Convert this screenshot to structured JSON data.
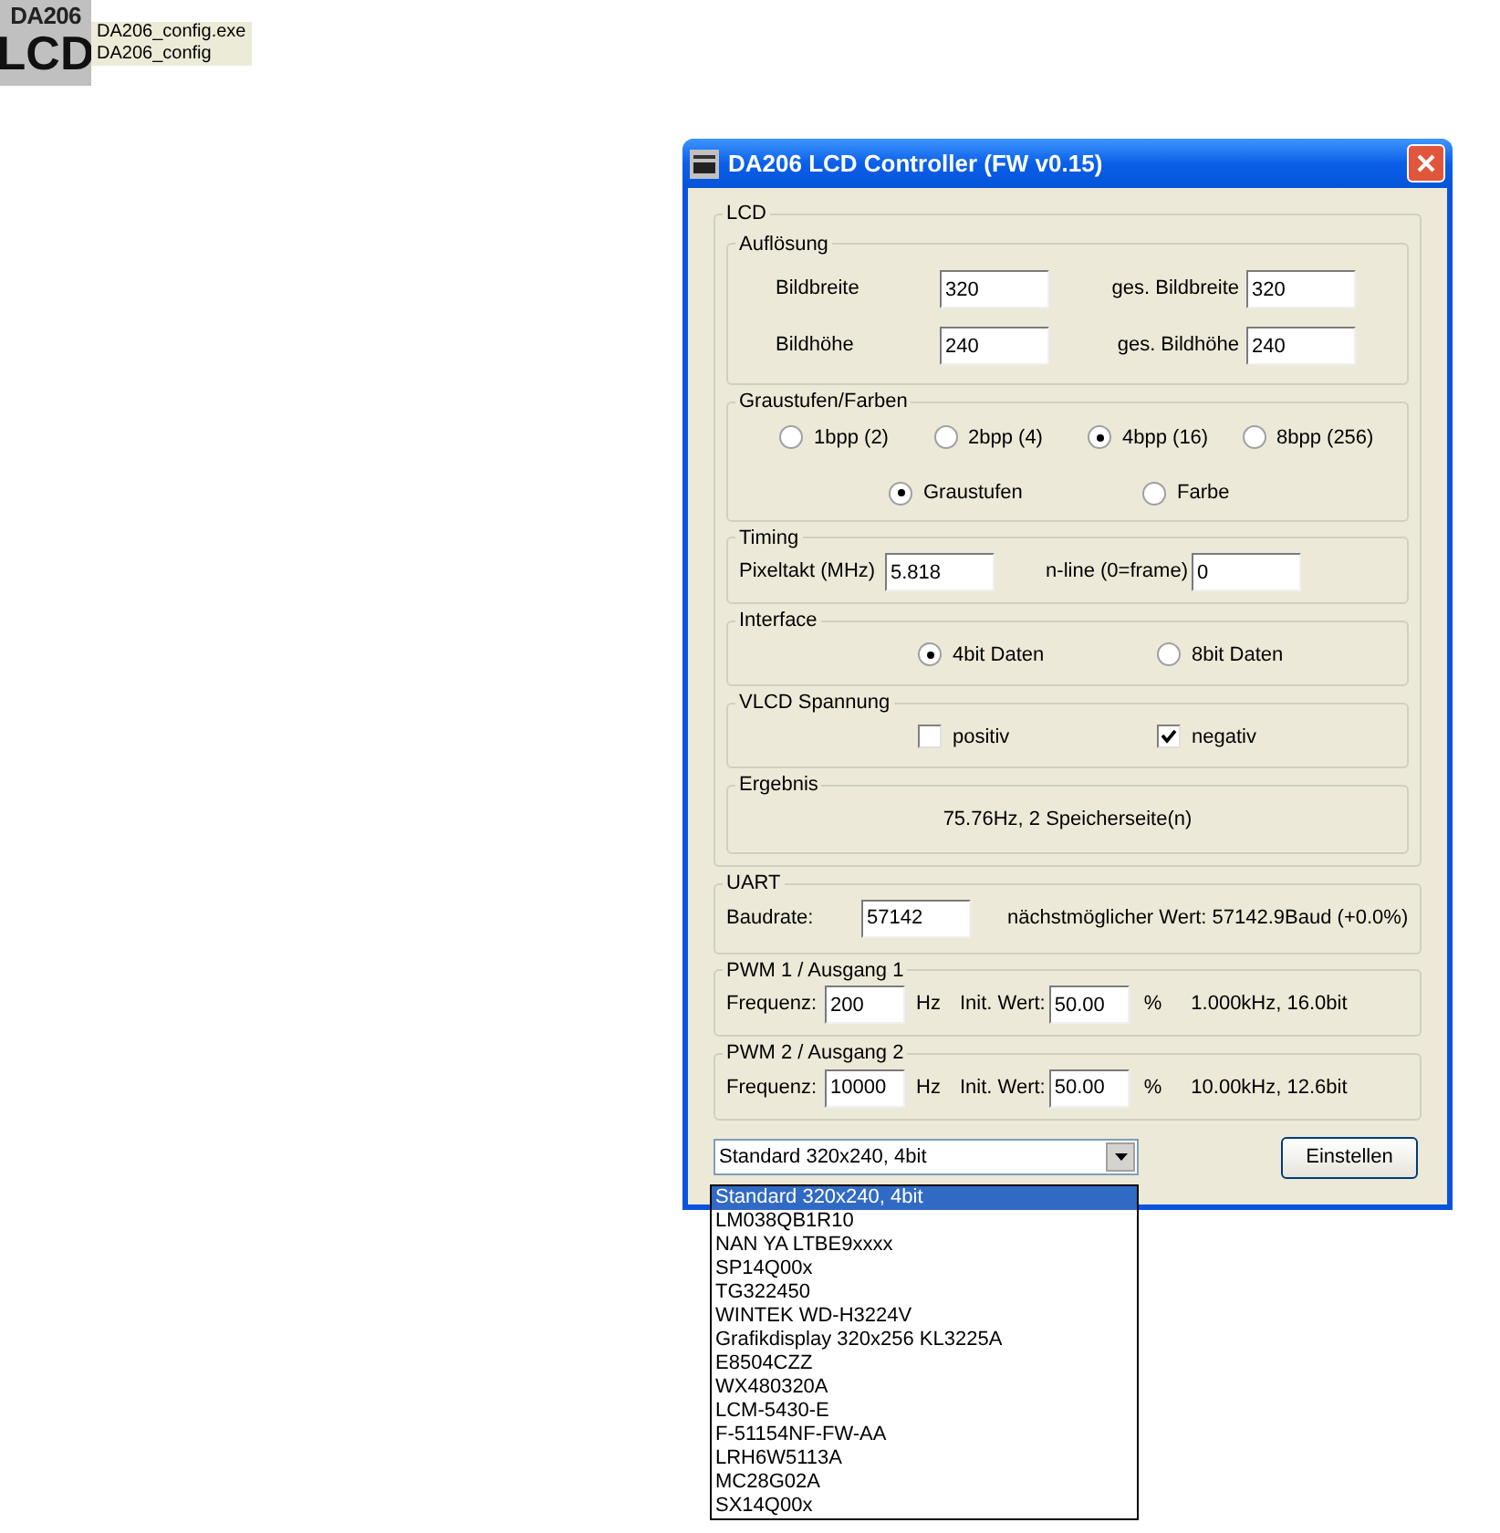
{
  "desktop_icon": {
    "logo_top": "DA206",
    "logo_bottom": "LCD",
    "lines": [
      "DA206_config.exe",
      "DA206_config"
    ]
  },
  "window": {
    "title": "DA206 LCD Controller (FW v0.15)"
  },
  "lcd": {
    "title": "LCD",
    "resolution": {
      "title": "Auflösung",
      "fields": [
        {
          "label": "Bildbreite",
          "value": "320"
        },
        {
          "label": "ges. Bildbreite",
          "value": "320"
        },
        {
          "label": "Bildhöhe",
          "value": "240"
        },
        {
          "label": "ges. Bildhöhe",
          "value": "240"
        }
      ]
    },
    "colors": {
      "title": "Graustufen/Farben",
      "depth": [
        {
          "label": "1bpp (2)",
          "selected": false
        },
        {
          "label": "2bpp (4)",
          "selected": false
        },
        {
          "label": "4bpp (16)",
          "selected": true
        },
        {
          "label": "8bpp (256)",
          "selected": false
        }
      ],
      "mode": [
        {
          "label": "Graustufen",
          "selected": true
        },
        {
          "label": "Farbe",
          "selected": false
        }
      ]
    },
    "timing": {
      "title": "Timing",
      "fields": [
        {
          "label": "Pixeltakt (MHz)",
          "value": "5.818"
        },
        {
          "label": "n-line (0=frame)",
          "value": "0"
        }
      ]
    },
    "interface": {
      "title": "Interface",
      "options": [
        {
          "label": "4bit Daten",
          "selected": true
        },
        {
          "label": "8bit Daten",
          "selected": false
        }
      ]
    },
    "vlcd": {
      "title": "VLCD Spannung",
      "options": [
        {
          "label": "positiv",
          "checked": false
        },
        {
          "label": "negativ",
          "checked": true
        }
      ]
    },
    "result": {
      "title": "Ergebnis",
      "text": "75.76Hz, 2 Speicherseite(n)"
    }
  },
  "uart": {
    "title": "UART",
    "label": "Baudrate:",
    "value": "57142",
    "info": "nächstmöglicher Wert: 57142.9Baud (+0.0%)"
  },
  "pwm": [
    {
      "title": "PWM 1 / Ausgang 1",
      "freq_label": "Frequenz:",
      "freq_value": "200",
      "freq_unit": "Hz",
      "init_label": "Init. Wert:",
      "init_value": "50.00",
      "init_unit": "%",
      "info": "1.000kHz, 16.0bit"
    },
    {
      "title": "PWM 2 / Ausgang 2",
      "freq_label": "Frequenz:",
      "freq_value": "10000",
      "freq_unit": "Hz",
      "init_label": "Init. Wert:",
      "init_value": "50.00",
      "init_unit": "%",
      "info": "10.00kHz, 12.6bit"
    }
  ],
  "preset": {
    "value": "Standard 320x240, 4bit",
    "options": [
      {
        "label": "Standard 320x240, 4bit",
        "selected": true
      },
      {
        "label": "LM038QB1R10",
        "selected": false
      },
      {
        "label": "NAN YA LTBE9xxxx",
        "selected": false
      },
      {
        "label": "SP14Q00x",
        "selected": false
      },
      {
        "label": "TG322450",
        "selected": false
      },
      {
        "label": "WINTEK WD-H3224V",
        "selected": false
      },
      {
        "label": "Grafikdisplay 320x256 KL3225A",
        "selected": false
      },
      {
        "label": "E8504CZZ",
        "selected": false
      },
      {
        "label": "WX480320A",
        "selected": false
      },
      {
        "label": "LCM-5430-E",
        "selected": false
      },
      {
        "label": "F-51154NF-FW-AA",
        "selected": false
      },
      {
        "label": "LRH6W5113A",
        "selected": false
      },
      {
        "label": "MC28G02A",
        "selected": false
      },
      {
        "label": "SX14Q00x",
        "selected": false
      }
    ]
  },
  "button": "Einstellen"
}
